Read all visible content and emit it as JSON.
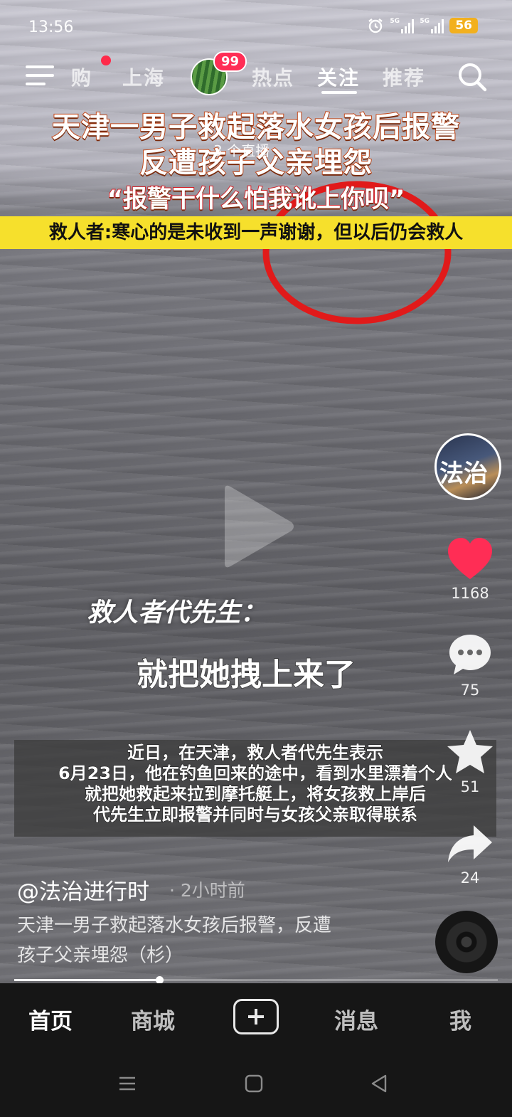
{
  "status_bar": {
    "time": "13:56",
    "signal1_tag": "5G",
    "signal2_tag": "5G",
    "battery": "56",
    "alarm_icon": "alarm-clock-icon"
  },
  "top_nav": {
    "tabs": [
      {
        "label": "购"
      },
      {
        "label": "上海"
      },
      {
        "label": "热点"
      },
      {
        "label": "关注"
      },
      {
        "label": "推荐"
      }
    ],
    "active_tab": "关注",
    "avatar_badge": "99"
  },
  "video": {
    "headline_line1": "天津一男子救起落水女孩后报警",
    "headline_line2": "反遭孩子父亲埋怨",
    "live_label": "3 个直播",
    "quote": "“报警干什么怕我讹上你呗”",
    "yellow_banner": "救人者:寒心的是未收到一声谢谢，但以后仍会救人",
    "speaker": "救人者代先生：",
    "speech": "就把她拽上来了",
    "caption_lines": [
      "近日，在天津，救人者代先生表示",
      "6月23日，他在钓鱼回来的途中，看到水里漂着个人",
      "就把她救起来拉到摩托艇上，将女孩救上岸后",
      "代先生立即报警并同时与女孩父亲取得联系"
    ],
    "creator_avatar_text": "法治",
    "accent_color": "#ff2d55"
  },
  "actions": {
    "like_count": "1168",
    "comment_count": "75",
    "favorite_count": "51",
    "share_count": "24"
  },
  "post": {
    "author": "@法治进行时",
    "time": "· 2小时前",
    "description_line1": "天津一男子救起落水女孩后报警，反遭",
    "description_line2": "孩子父亲埋怨（杉）",
    "progress": 0.3
  },
  "bottom_nav": {
    "home": "首页",
    "mall": "商城",
    "messages": "消息",
    "me": "我"
  }
}
